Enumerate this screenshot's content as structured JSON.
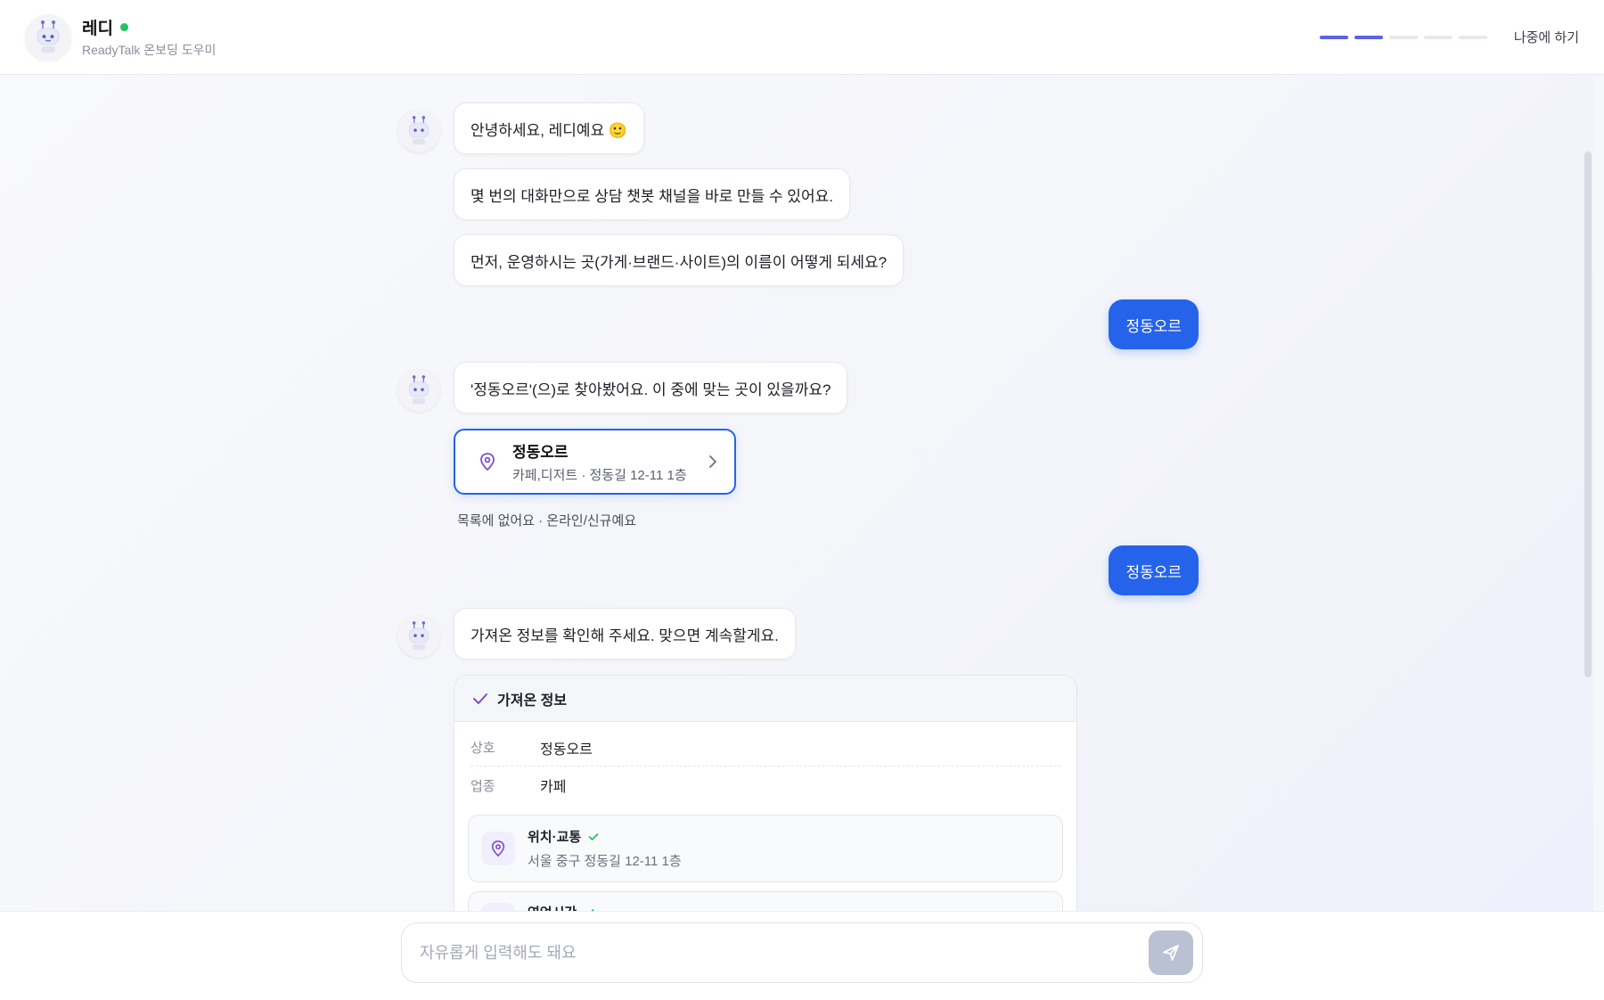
{
  "header": {
    "assistant_name": "레디",
    "assistant_subtitle": "ReadyTalk 온보딩 도우미",
    "progress_steps": 5,
    "progress_done": 2,
    "later_label": "나중에 하기"
  },
  "messages": {
    "greeting": "안녕하세요, 레디예요 🙂",
    "intro": "몇 번의 대화만으로 상담 챗봇 채널을 바로 만들 수 있어요.",
    "ask_name": "먼저, 운영하시는 곳(가게·브랜드·사이트)의 이름이 어떻게 되세요?",
    "user_reply_1": "정동오르",
    "search_result": "'정동오르'(으)로 찾아봤어요. 이 중에 맞는 곳이 있을까요?",
    "user_reply_2": "정동오르",
    "confirm_prompt": "가져온 정보를 확인해 주세요. 맞으면 계속할게요."
  },
  "place_result": {
    "name": "정동오르",
    "meta": "카페,디저트 · 정동길 12-11 1층"
  },
  "not_listed_label": "목록에 없어요 · 온라인/신규예요",
  "fetched_info": {
    "title": "가져온 정보",
    "rows": [
      {
        "key": "상호",
        "value": "정동오르"
      },
      {
        "key": "업종",
        "value": "카페"
      }
    ],
    "location": {
      "title": "위치·교통",
      "desc": "서울 중구 정동길 12-11 1층"
    },
    "hours": {
      "title": "영업시간"
    }
  },
  "input": {
    "placeholder": "자유롭게 입력해도 돼요"
  },
  "colors": {
    "accent": "#2563eb",
    "progress_active": "#5b63e6",
    "online": "#22c55e",
    "icon_purple": "#7c4dcc"
  }
}
